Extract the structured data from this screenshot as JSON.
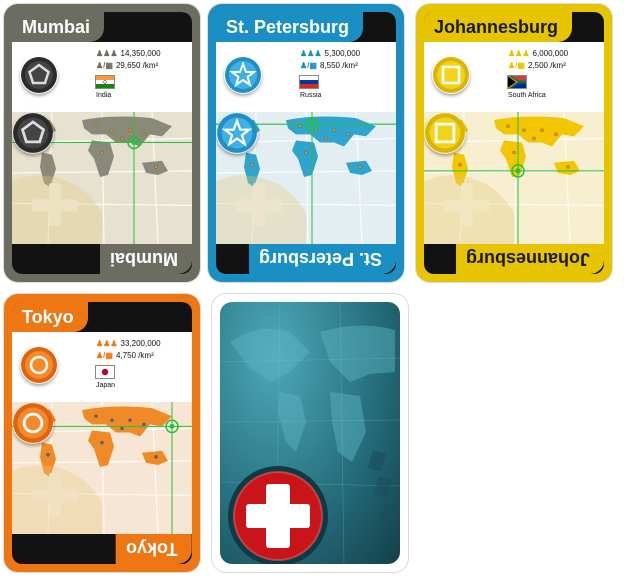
{
  "cards": [
    {
      "id": "mumbai",
      "city": "Mumbai",
      "population": "14,350,000",
      "density": "29,650 /km²",
      "country": "India",
      "color": "#6f6f63",
      "border_color": "#6c6c60",
      "token_shape": "pentagon-icon",
      "token_color": "#2c2c2c"
    },
    {
      "id": "st-petersburg",
      "city": "St. Petersburg",
      "population": "5,300,000",
      "density": "8,550 /km²",
      "country": "Russia",
      "color": "#1f9fd4",
      "border_color": "#1a8fc4",
      "token_shape": "star-icon",
      "token_color": "#2a9fd6"
    },
    {
      "id": "johannesburg",
      "city": "Johannesburg",
      "population": "6,000,000",
      "density": "2,500 /km²",
      "country": "South Africa",
      "color": "#f2cc00",
      "border_color": "#e6c400",
      "token_shape": "square-icon",
      "token_color": "#f2cc00"
    },
    {
      "id": "tokyo",
      "city": "Tokyo",
      "population": "33,200,000",
      "density": "4,750 /km²",
      "country": "Japan",
      "color": "#f07a16",
      "border_color": "#ee7613",
      "token_shape": "circle-icon",
      "token_color": "#f07a16"
    }
  ]
}
